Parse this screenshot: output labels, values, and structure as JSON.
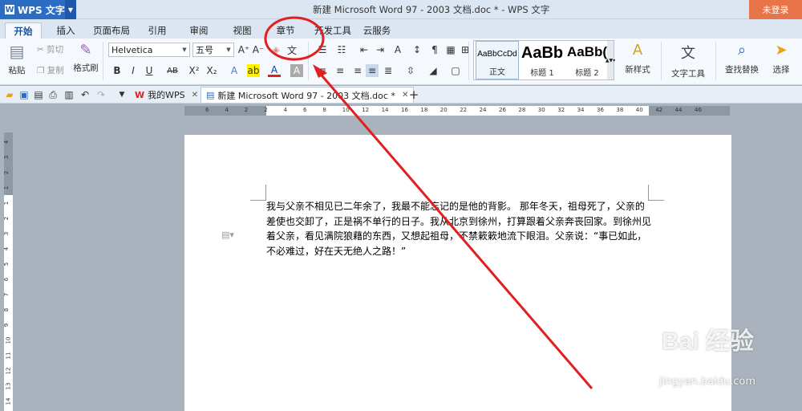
{
  "titlebar": {
    "app_name": "WPS 文字",
    "window_title": "新建 Microsoft Word 97 - 2003 文档.doc * - WPS 文字",
    "login": "未登录"
  },
  "menu_tabs": [
    "开始",
    "插入",
    "页面布局",
    "引用",
    "审阅",
    "视图",
    "章节",
    "开发工具",
    "云服务"
  ],
  "ribbon": {
    "paste": "粘贴",
    "cut": "剪切",
    "copy": "复制",
    "format_painter": "格式刷",
    "font_name": "Helvetica",
    "font_size": "五号",
    "styles": [
      {
        "preview": "AaBbCcDd",
        "name": "正文"
      },
      {
        "preview": "AaBb",
        "name": "标题 1"
      },
      {
        "preview": "AaBb(",
        "name": "标题 2"
      }
    ],
    "new_style": "新样式",
    "text_tools": "文字工具",
    "find_replace": "查找替换",
    "select": "选择"
  },
  "doc_tabs": [
    {
      "label": "我的WPS"
    },
    {
      "label": "新建 Microsoft Word 97 - 2003 文档.doc *"
    }
  ],
  "ruler_h": [
    "6",
    "4",
    "2",
    "2",
    "4",
    "6",
    "8",
    "10",
    "12",
    "14",
    "16",
    "18",
    "20",
    "22",
    "24",
    "26",
    "28",
    "30",
    "32",
    "34",
    "36",
    "38",
    "40",
    "42",
    "44",
    "46"
  ],
  "ruler_v": [
    "4",
    "3",
    "2",
    "1",
    "1",
    "2",
    "3",
    "4",
    "5",
    "6",
    "7",
    "8",
    "9",
    "10",
    "11",
    "12",
    "13",
    "14"
  ],
  "document": {
    "lines": [
      "我与父亲不相见已二年余了，我最不能忘记的是他的背影。 那年冬天，祖母死了，父亲的",
      "差使也交卸了，正是祸不单行的日子。我从北京到徐州，打算跟着父亲奔丧回家。到徐州见",
      "着父亲，看见满院狼藉的东西，又想起祖母，不禁簌簌地流下眼泪。父亲说：“事已如此，",
      "不必难过，好在天无绝人之路！”"
    ]
  },
  "watermark": {
    "brand": "Bai 经验",
    "url": "jingyan.baidu.com"
  },
  "colors": {
    "annotation": "#e02020",
    "accent": "#2b6cc4",
    "login": "#e8754a"
  }
}
